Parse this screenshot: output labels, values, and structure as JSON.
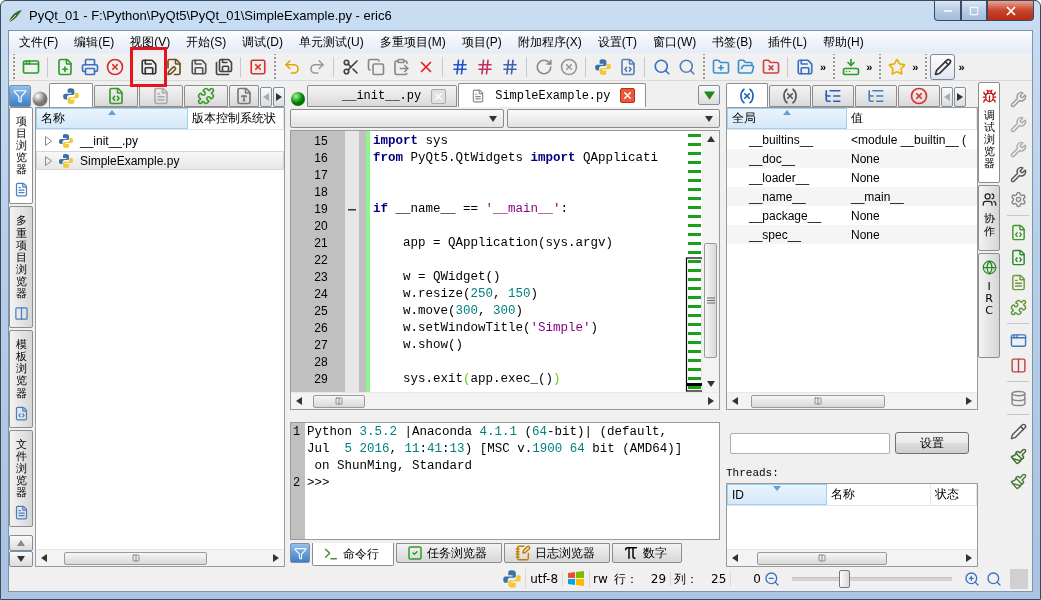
{
  "window": {
    "title": "PyQt_01 - F:\\Python\\PyQt5\\PyQt_01\\SimpleExample.py - eric6"
  },
  "menu": [
    "文件(F)",
    "编辑(E)",
    "视图(V)",
    "开始(S)",
    "调试(D)",
    "单元测试(U)",
    "多重项目(M)",
    "项目(P)",
    "附加程序(X)",
    "设置(T)",
    "窗口(W)",
    "书签(B)",
    "插件(L)",
    "帮助(H)"
  ],
  "toolbar": [
    {
      "sections": [
        [
          {
            "kind": "new-project",
            "on": false,
            "marked": false
          }
        ],
        [
          {
            "kind": "new-file",
            "on": false,
            "marked": false
          },
          {
            "kind": "print",
            "on": false,
            "marked": false
          },
          {
            "kind": "close-file",
            "on": false,
            "marked": false
          }
        ],
        [
          {
            "kind": "save",
            "on": false,
            "marked": true
          },
          {
            "kind": "save-as",
            "on": false,
            "marked": false
          },
          {
            "kind": "save-copy",
            "on": false,
            "marked": false
          },
          {
            "kind": "save-all",
            "on": false,
            "marked": false
          }
        ],
        [
          {
            "kind": "close-all",
            "on": false,
            "marked": false
          }
        ]
      ]
    },
    {
      "sections": [
        [
          {
            "kind": "undo",
            "on": false,
            "marked": false
          },
          {
            "kind": "redo",
            "on": false,
            "marked": false
          }
        ],
        [
          {
            "kind": "cut",
            "on": false,
            "marked": false
          },
          {
            "kind": "copy",
            "on": false,
            "marked": false
          },
          {
            "kind": "paste",
            "on": false,
            "marked": false
          },
          {
            "kind": "delete",
            "on": false,
            "marked": false
          }
        ],
        [
          {
            "kind": "comment",
            "on": false,
            "marked": false
          },
          {
            "kind": "uncomment",
            "on": false,
            "marked": false
          },
          {
            "kind": "toggle-comment",
            "on": false,
            "marked": false
          }
        ],
        [
          {
            "kind": "reload",
            "on": false,
            "marked": false
          },
          {
            "kind": "stop",
            "on": false,
            "marked": false
          }
        ],
        [
          {
            "kind": "python",
            "on": false,
            "marked": false
          },
          {
            "kind": "python-doc",
            "on": false,
            "marked": false
          }
        ],
        [
          {
            "kind": "python-search",
            "on": false,
            "marked": false
          },
          {
            "kind": "search-doc",
            "on": false,
            "marked": false
          }
        ]
      ]
    },
    {
      "sections": [
        [
          {
            "kind": "project-add",
            "on": false,
            "marked": false
          },
          {
            "kind": "project-open",
            "on": false,
            "marked": false
          },
          {
            "kind": "project-close",
            "on": false,
            "marked": false
          }
        ],
        [
          {
            "kind": "project-save",
            "on": false,
            "marked": false
          }
        ]
      ],
      "more": "»"
    },
    {
      "sections": [
        [
          {
            "kind": "download",
            "on": false,
            "marked": false
          }
        ]
      ],
      "more": "»"
    },
    {
      "sections": [
        [
          {
            "kind": "star",
            "on": false,
            "marked": false
          }
        ]
      ],
      "more": "»"
    },
    {
      "sections": [
        [
          {
            "kind": "edit",
            "on": true,
            "marked": false
          }
        ]
      ],
      "more": "»"
    }
  ],
  "left_panel": {
    "tabs": [
      {
        "kind": "python",
        "selected": true
      },
      {
        "kind": "green-doc",
        "selected": false
      },
      {
        "kind": "doc",
        "selected": false
      },
      {
        "kind": "puzzle",
        "selected": false
      },
      {
        "kind": "idl",
        "selected": false
      }
    ],
    "side_tabs": [
      {
        "label": "项目浏览器",
        "selected": true
      },
      {
        "label": "多重项目浏览器",
        "selected": false
      },
      {
        "label": "模板浏览器",
        "selected": false
      },
      {
        "label": "文件浏览器",
        "selected": false
      }
    ],
    "columns": [
      "名称",
      "版本控制系统状"
    ],
    "items": [
      {
        "label": "__init__.py",
        "selected": false
      },
      {
        "label": "SimpleExample.py",
        "selected": true
      }
    ]
  },
  "editor": {
    "tabs": [
      {
        "label": "__init__.py",
        "selected": false
      },
      {
        "label": "SimpleExample.py",
        "selected": true
      }
    ],
    "lines": [
      {
        "number": "15",
        "fold": false,
        "tokens": [
          {
            "keyword": "import"
          },
          {
            "plain": " sys"
          }
        ]
      },
      {
        "number": "16",
        "fold": false,
        "tokens": [
          {
            "keyword": "from"
          },
          {
            "plain": " PyQt5.QtWidgets "
          },
          {
            "keyword": "import"
          },
          {
            "plain": " QApplicati"
          }
        ]
      },
      {
        "number": "17",
        "fold": false
      },
      {
        "number": "18",
        "fold": false
      },
      {
        "number": "19",
        "fold": true,
        "tokens": [
          {
            "keyword": "if"
          },
          {
            "plain": " __name__ == "
          },
          {
            "string": "'__main__'"
          },
          {
            "plain": ":"
          }
        ]
      },
      {
        "number": "20",
        "fold": false
      },
      {
        "number": "21",
        "fold": false,
        "tokens": [
          {
            "plain": "    app = QApplication(sys.argv)"
          }
        ]
      },
      {
        "number": "22",
        "fold": false
      },
      {
        "number": "23",
        "fold": false,
        "tokens": [
          {
            "plain": "    w = QWidget()"
          }
        ]
      },
      {
        "number": "24",
        "fold": false,
        "tokens": [
          {
            "plain": "    w.resize("
          },
          {
            "number": "250"
          },
          {
            "plain": ", "
          },
          {
            "number": "150"
          },
          {
            "plain": ")"
          }
        ]
      },
      {
        "number": "25",
        "fold": false,
        "tokens": [
          {
            "plain": "    w.move("
          },
          {
            "number": "300"
          },
          {
            "plain": ", "
          },
          {
            "number": "300"
          },
          {
            "plain": ")"
          }
        ]
      },
      {
        "number": "26",
        "fold": false,
        "tokens": [
          {
            "plain": "    w.setWindowTitle("
          },
          {
            "string": "'Simple'"
          },
          {
            "plain": ")"
          }
        ]
      },
      {
        "number": "27",
        "fold": false,
        "tokens": [
          {
            "plain": "    w.show()"
          }
        ]
      },
      {
        "number": "28",
        "fold": false
      },
      {
        "number": "29",
        "fold": false,
        "tokens": [
          {
            "plain": "    sys.exit"
          },
          {
            "brace": "("
          },
          {
            "plain": "app.exec_()"
          },
          {
            "brace": ")"
          }
        ]
      }
    ]
  },
  "shell": {
    "lines": [
      {
        "number": "1",
        "rows": [
          {
            "tokens": [
              {
                "plain": "Python "
              },
              {
                "number": "3.5.2"
              },
              {
                "plain": " |Anaconda "
              },
              {
                "number": "4.1.1"
              },
              {
                "plain": " ("
              },
              {
                "number": "64"
              },
              {
                "plain": "-bit)| (default,"
              }
            ]
          },
          {
            "tokens": [
              {
                "plain": "Jul  "
              },
              {
                "number": "5 2016"
              },
              {
                "plain": ", "
              },
              {
                "number": "11"
              },
              {
                "plain": ":"
              },
              {
                "number": "41"
              },
              {
                "plain": ":"
              },
              {
                "number": "13"
              },
              {
                "plain": ") [MSC v."
              },
              {
                "number": "1900 64"
              },
              {
                "plain": " bit (AMD64)]"
              }
            ]
          },
          {
            "tokens": [
              {
                "plain": " on ShunMing, Standard"
              }
            ]
          }
        ]
      },
      {
        "number": "2",
        "rows": [
          {
            "tokens": [
              {
                "plain": ">>>"
              }
            ]
          }
        ]
      }
    ]
  },
  "bottom_tabs": [
    {
      "kind": "shell",
      "label": "命令行",
      "selected": true
    },
    {
      "kind": "tasks",
      "label": "任务浏览器",
      "selected": false
    },
    {
      "kind": "log",
      "label": "日志浏览器",
      "selected": false
    },
    {
      "kind": "numbers",
      "label": "数字",
      "selected": false
    }
  ],
  "debug_panel": {
    "tabs": [
      {
        "kind": "globals",
        "selected": true
      },
      {
        "kind": "locals",
        "selected": false
      },
      {
        "kind": "stack",
        "selected": false
      },
      {
        "kind": "stack-tree",
        "selected": false
      },
      {
        "kind": "breakpoints",
        "selected": false
      }
    ],
    "columns": [
      "全局",
      "值"
    ],
    "variables": [
      {
        "name": "__builtins__",
        "value": "<module __builtin__ ("
      },
      {
        "name": "__doc__",
        "value": "None"
      },
      {
        "name": "__loader__",
        "value": "None"
      },
      {
        "name": "__name__",
        "value": "__main__"
      },
      {
        "name": "__package__",
        "value": "None"
      },
      {
        "name": "__spec__",
        "value": "None"
      }
    ],
    "filter_button": "设置",
    "threads_label": "Threads:",
    "thread_columns": [
      "ID",
      "名称",
      "状态"
    ]
  },
  "side_tabs_right": [
    {
      "label": "调试浏览器",
      "selected": true
    },
    {
      "label": "协作",
      "selected": false
    },
    {
      "label": "IRC",
      "selected": false
    }
  ],
  "status_bar": {
    "encoding": "utf-8",
    "mode": "rw",
    "line_label": "行：",
    "line": "29",
    "column_label": "列：",
    "column": "25",
    "zoom": "0",
    "zoom_slider": {
      "level": 0.33
    }
  }
}
